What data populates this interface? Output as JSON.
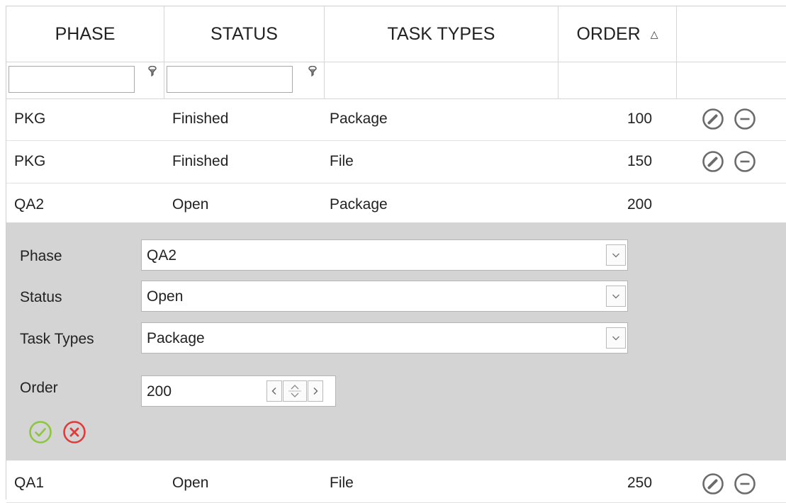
{
  "columns": [
    {
      "label": "PHASE"
    },
    {
      "label": "STATUS"
    },
    {
      "label": "TASK TYPES"
    },
    {
      "label": "ORDER",
      "sort": "ascending"
    },
    {
      "label": ""
    }
  ],
  "filters": {
    "phase": "",
    "status": ""
  },
  "rows": [
    {
      "phase": "PKG",
      "status": "Finished",
      "task_types": "Package",
      "order": "100",
      "editing": false
    },
    {
      "phase": "PKG",
      "status": "Finished",
      "task_types": "File",
      "order": "150",
      "editing": false
    },
    {
      "phase": "QA2",
      "status": "Open",
      "task_types": "Package",
      "order": "200",
      "editing": true
    },
    {
      "phase": "QA1",
      "status": "Open",
      "task_types": "File",
      "order": "250",
      "editing": false
    }
  ],
  "editor": {
    "phase_label": "Phase",
    "phase_value": "QA2",
    "status_label": "Status",
    "status_value": "Open",
    "task_types_label": "Task Types",
    "task_types_value": "Package",
    "order_label": "Order",
    "order_value": "200"
  },
  "icons": {
    "filter": "filter-icon",
    "edit": "pencil-circle-icon",
    "delete": "minus-circle-icon",
    "confirm": "check-circle-icon",
    "cancel": "x-circle-icon",
    "sort": "sort-ascending-icon"
  },
  "colors": {
    "icon_gray": "#6b6b6b",
    "confirm_green": "#8cc63f",
    "cancel_red": "#e03a3a",
    "editor_bg": "#d4d4d4",
    "grid_line": "#d6d6d6"
  }
}
